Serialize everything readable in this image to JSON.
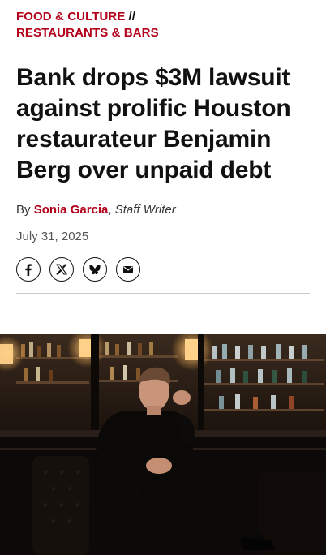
{
  "kicker": {
    "section": "FOOD & CULTURE",
    "separator": "//",
    "subsection": "RESTAURANTS & BARS"
  },
  "headline": "Bank drops $3M lawsuit against prolific Houston restaurateur Benjamin Berg over unpaid debt",
  "byline": {
    "prefix": "By",
    "author": "Sonia Garcia",
    "comma": ",",
    "role": "Staff Writer"
  },
  "date": "July 31, 2025",
  "share": [
    {
      "name": "facebook-icon"
    },
    {
      "name": "x-icon"
    },
    {
      "name": "bluesky-icon"
    },
    {
      "name": "email-icon"
    }
  ],
  "colors": {
    "accent": "#b3001b",
    "text": "#111111",
    "muted": "#555555",
    "divider": "#c9c9c9"
  }
}
